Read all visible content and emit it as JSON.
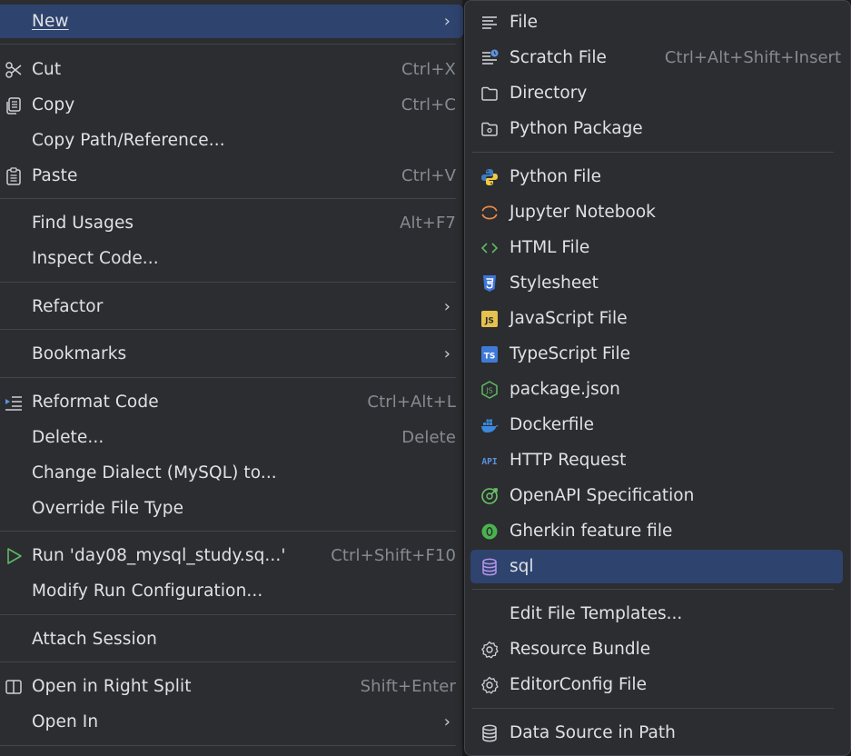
{
  "left_menu": {
    "new": {
      "label": "New"
    },
    "cut": {
      "label": "Cut",
      "shortcut": "Ctrl+X"
    },
    "copy": {
      "label": "Copy",
      "shortcut": "Ctrl+C"
    },
    "copy_path": {
      "label": "Copy Path/Reference..."
    },
    "paste": {
      "label": "Paste",
      "shortcut": "Ctrl+V"
    },
    "find_usages": {
      "label": "Find Usages",
      "shortcut": "Alt+F7"
    },
    "inspect_code": {
      "label": "Inspect Code..."
    },
    "refactor": {
      "label": "Refactor"
    },
    "bookmarks": {
      "label": "Bookmarks"
    },
    "reformat_code": {
      "label": "Reformat Code",
      "shortcut": "Ctrl+Alt+L"
    },
    "delete": {
      "label": "Delete...",
      "shortcut": "Delete"
    },
    "change_dialect": {
      "label": "Change Dialect (MySQL) to..."
    },
    "override_file_type": {
      "label": "Override File Type"
    },
    "run": {
      "label": "Run 'day08_mysql_study.sq...'",
      "shortcut": "Ctrl+Shift+F10"
    },
    "modify_run": {
      "label": "Modify Run Configuration..."
    },
    "attach_session": {
      "label": "Attach Session"
    },
    "open_right_split": {
      "label": "Open in Right Split",
      "shortcut": "Shift+Enter"
    },
    "open_in": {
      "label": "Open In"
    }
  },
  "submenu": {
    "file": {
      "label": "File"
    },
    "scratch_file": {
      "label": "Scratch File",
      "shortcut": "Ctrl+Alt+Shift+Insert"
    },
    "directory": {
      "label": "Directory"
    },
    "python_package": {
      "label": "Python Package"
    },
    "python_file": {
      "label": "Python File"
    },
    "jupyter_notebook": {
      "label": "Jupyter Notebook"
    },
    "html_file": {
      "label": "HTML File"
    },
    "stylesheet": {
      "label": "Stylesheet"
    },
    "javascript_file": {
      "label": "JavaScript File"
    },
    "typescript_file": {
      "label": "TypeScript File"
    },
    "package_json": {
      "label": "package.json"
    },
    "dockerfile": {
      "label": "Dockerfile"
    },
    "http_request": {
      "label": "HTTP Request"
    },
    "openapi_spec": {
      "label": "OpenAPI Specification"
    },
    "gherkin": {
      "label": "Gherkin feature file"
    },
    "sql": {
      "label": "sql"
    },
    "edit_templates": {
      "label": "Edit File Templates..."
    },
    "resource_bundle": {
      "label": "Resource Bundle"
    },
    "editorconfig": {
      "label": "EditorConfig File"
    },
    "data_source_path": {
      "label": "Data Source in Path"
    }
  },
  "icons": {
    "api_text": "API",
    "js_text": "JS",
    "ts_text": "TS"
  },
  "colors": {
    "selection": "#2e436e",
    "background": "#2b2d30",
    "text": "#dfe1e5",
    "shortcut": "#868a91",
    "run_green": "#5fb865",
    "python_blue": "#3d7bc0",
    "python_yellow": "#f0c842",
    "jupyter_orange": "#e9894a",
    "html_green": "#5fb865",
    "css_blue": "#3f74d9",
    "js_yellow": "#e5c14d",
    "ts_blue": "#3f7ad8",
    "node_green": "#5fb865",
    "docker_blue": "#3c88dd",
    "api_blue": "#5d93e0",
    "openapi_green": "#6cc46a",
    "gherkin_green": "#4ab34f",
    "sql_purple": "#b695e8"
  }
}
